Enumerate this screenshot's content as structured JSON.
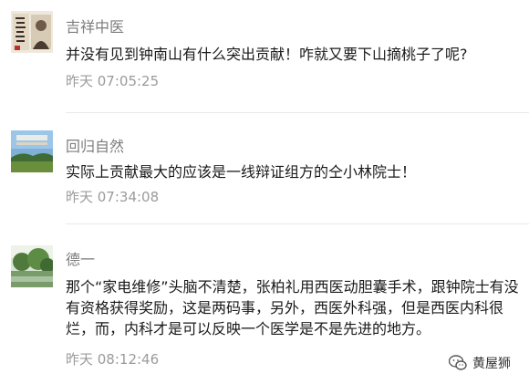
{
  "comments": [
    {
      "user": "吉祥中医",
      "avatar_icon": "calligraphy-portrait-avatar",
      "text": "并没有见到钟南山有什么突出贡献！咋就又要下山摘桃子了呢?",
      "time": "昨天 07:05:25"
    },
    {
      "user": "回归自然",
      "avatar_icon": "landscape-field-avatar",
      "text": "实际上贡献最大的应该是一线辩证组方的仝小林院士！",
      "time": "昨天 07:34:08"
    },
    {
      "user": "德一",
      "avatar_icon": "garden-pond-avatar",
      "text": "那个“家电维修”头脑不清楚，张柏礼用西医动胆囊手术，跟钟院士有没有资格获得奖励，这是两码事，另外，西医外科强，但是西医内科很烂，而，内科才是可以反映一个医学是不是先进的地方。",
      "time": "昨天 08:12:46"
    }
  ],
  "watermark": {
    "text": "黄屋狮",
    "icon": "wechat-logo-icon"
  },
  "colors": {
    "name": "#7d7d7d",
    "text": "#1a1a1a",
    "time": "#9b9b9b",
    "divider": "#e9e9e9"
  }
}
